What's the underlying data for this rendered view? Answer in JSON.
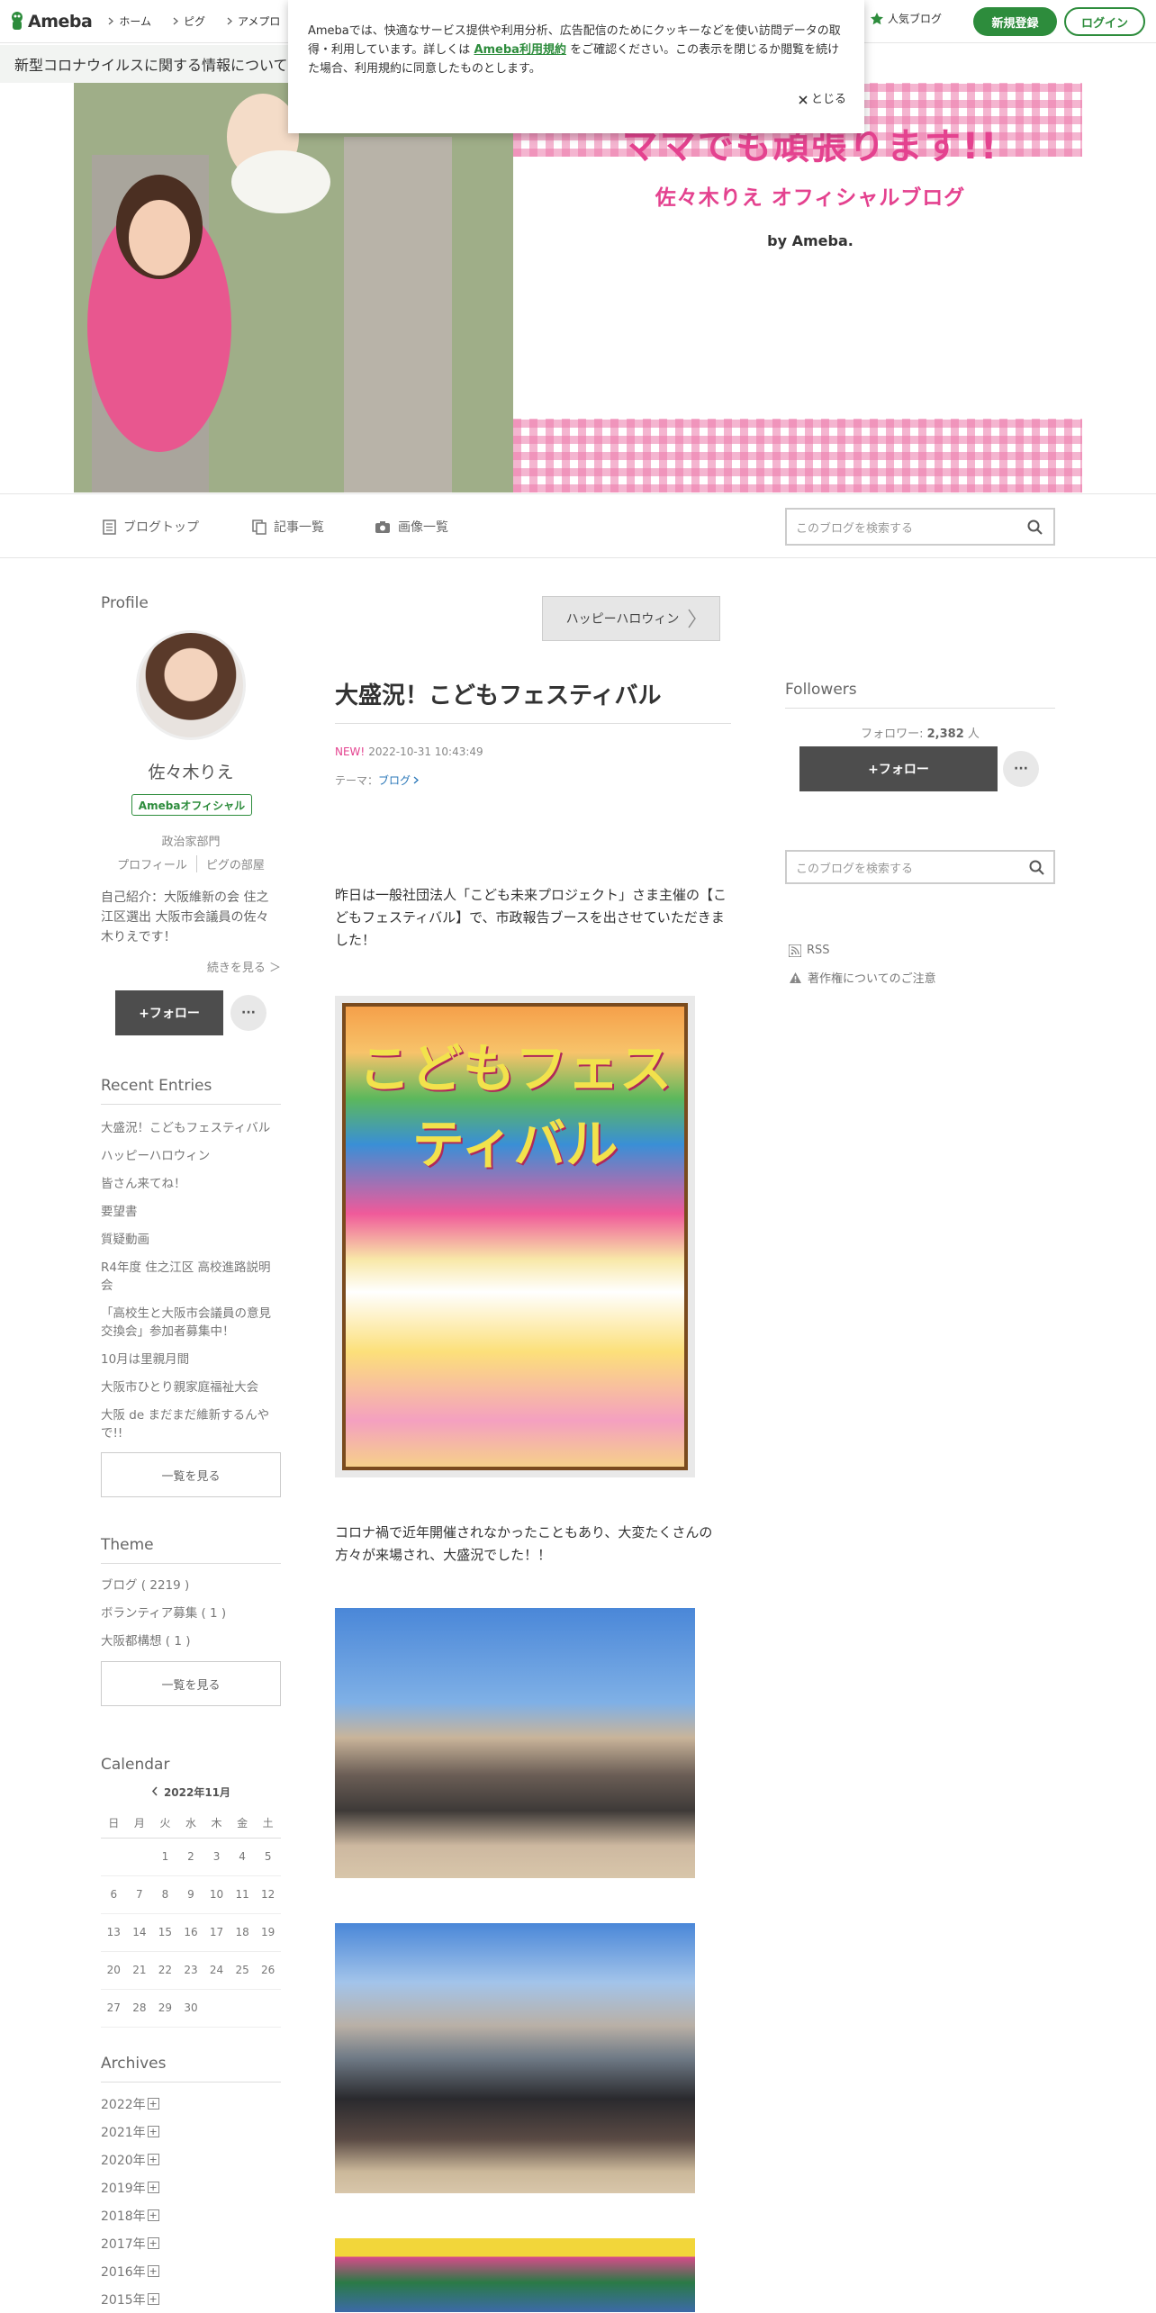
{
  "topbar": {
    "logo": "Ameba",
    "nav": [
      "ホーム",
      "ピグ",
      "アメプロ"
    ],
    "popular": "人気ブログ",
    "register": "新規登録",
    "login": "ログイン"
  },
  "covid_banner": "新型コロナウイルスに関する情報について",
  "cookie": {
    "text_before": "Amebaでは、快適なサービス提供や利用分析、広告配信のためにクッキーなどを使い訪問データの取得・利用しています。詳しくは ",
    "link": "Ameba利用規約",
    "text_after": " をご確認ください。この表示を閉じるか閲覧を続けた場合、利用規約に同意したものとします。",
    "close": "とじる"
  },
  "header": {
    "title": "ママでも頑張ります!!",
    "subtitle": "佐々木りえ オフィシャルブログ",
    "by": "by Ameba."
  },
  "blognav": {
    "top": "ブログトップ",
    "entries": "記事一覧",
    "images": "画像一覧",
    "search_placeholder": "このブログを検索する"
  },
  "profile": {
    "heading": "Profile",
    "name": "佐々木りえ",
    "badge": "Amebaオフィシャル",
    "type": "政治家部門",
    "link1": "プロフィール",
    "link2": "ピグの部屋",
    "intro": "自己紹介：大阪維新の会 住之江区選出 大阪市会議員の佐々木りえです！",
    "more": "続きを見る ＞",
    "follow": "+フォロー",
    "dots": "···"
  },
  "recent": {
    "heading": "Recent Entries",
    "items": [
      "大盛況！こどもフェスティバル",
      "ハッピーハロウィン",
      "皆さん来てね！",
      "要望書",
      "質疑動画",
      "R4年度 住之江区 高校進路説明会",
      "「高校生と大阪市会議員の意見交換会」参加者募集中！",
      "10月は里親月間",
      "大阪市ひとり親家庭福祉大会",
      "大阪 de まだまだ維新するんやで!!"
    ],
    "see_all": "一覧を見る"
  },
  "theme": {
    "heading": "Theme",
    "items": [
      "ブログ ( 2219 )",
      "ボランティア募集 ( 1 )",
      "大阪都構想 ( 1 )"
    ],
    "see_all": "一覧を見る"
  },
  "calendar": {
    "heading": "Calendar",
    "month": "2022年11月",
    "weekdays": [
      "日",
      "月",
      "火",
      "水",
      "木",
      "金",
      "土"
    ],
    "weeks": [
      [
        "",
        "",
        "1",
        "2",
        "3",
        "4",
        "5"
      ],
      [
        "6",
        "7",
        "8",
        "9",
        "10",
        "11",
        "12"
      ],
      [
        "13",
        "14",
        "15",
        "16",
        "17",
        "18",
        "19"
      ],
      [
        "20",
        "21",
        "22",
        "23",
        "24",
        "25",
        "26"
      ],
      [
        "27",
        "28",
        "29",
        "30",
        "",
        "",
        ""
      ]
    ]
  },
  "archives": {
    "heading": "Archives",
    "items": [
      "2022年",
      "2021年",
      "2020年",
      "2019年",
      "2018年",
      "2017年",
      "2016年",
      "2015年"
    ]
  },
  "article": {
    "prev_button": "ハッピーハロウィン",
    "title": "大盛況！こどもフェスティバル",
    "new": "NEW!",
    "date": "2022-10-31 10:43:49",
    "theme_label": "テーマ：",
    "theme": "ブログ",
    "para1": "昨日は一般社団法人「こども未来プロジェクト」さま主催の【こどもフェスティバル】で、市政報告ブースを出させていただきました！",
    "para2": "コロナ禍で近年開催されなかったこともあり、大変たくさんの方々が来場され、大盛況でした！！",
    "poster_title": "こどもフェスティバル"
  },
  "sidebar_right": {
    "followers_heading": "Followers",
    "follower_label": "フォロワー: ",
    "follower_count": "2,382",
    "follower_unit": " 人",
    "follow": "+フォロー",
    "dots": "···",
    "search_placeholder": "このブログを検索する",
    "rss": "RSS",
    "copyright": "著作権についてのご注意"
  }
}
